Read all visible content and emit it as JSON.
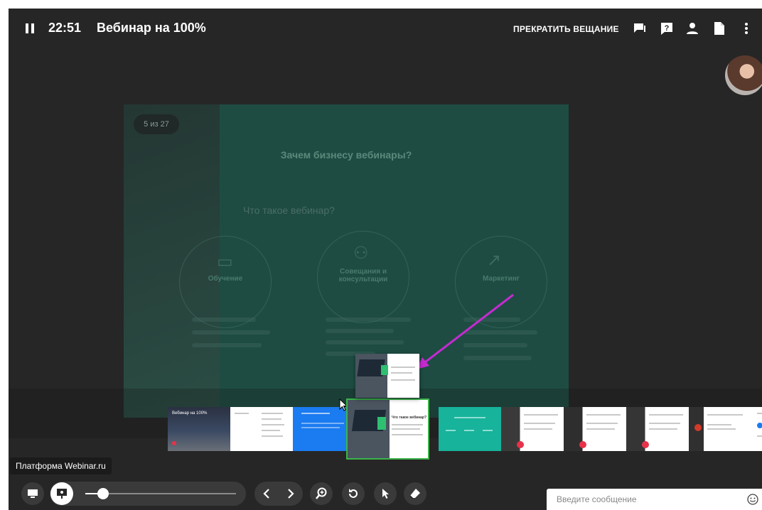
{
  "header": {
    "time": "22:51",
    "title": "Вебинар на 100%",
    "stop_label": "ПРЕКРАТИТЬ ВЕЩАНИЕ",
    "icons": [
      "chat-icon",
      "question-icon",
      "person-icon",
      "document-icon",
      "more-icon"
    ]
  },
  "slide": {
    "counter": "5 из 27",
    "heading": "Зачем бизнесу вебинары?",
    "subheading": "Что такое вебинар?",
    "blocks": [
      {
        "label": "Обучение"
      },
      {
        "label": "Совещания и консультации"
      },
      {
        "label": "Маркетинг"
      }
    ]
  },
  "thumbnails": {
    "items": [
      {
        "title": "Вебинар на 100%",
        "kind": "dark"
      },
      {
        "title": "",
        "kind": "white"
      },
      {
        "title": "",
        "kind": "blue"
      },
      {
        "title": "",
        "kind": "active"
      },
      {
        "title": "",
        "kind": "teal"
      },
      {
        "title": "",
        "kind": "photo"
      },
      {
        "title": "",
        "kind": "photo"
      },
      {
        "title": "",
        "kind": "photo"
      },
      {
        "title": "",
        "kind": "photo"
      },
      {
        "title": "",
        "kind": "white"
      }
    ],
    "active_title": "Что такое вебинар?"
  },
  "tooltip": "Платформа Webinar.ru",
  "controls": {
    "zoom_level": 0.12
  },
  "chat": {
    "placeholder": "Введите сообщение"
  },
  "colors": {
    "active_border": "#3bb44a",
    "arrow": "#c42bd0",
    "badge": "#e8324a",
    "slide_tint": "#12806c"
  }
}
